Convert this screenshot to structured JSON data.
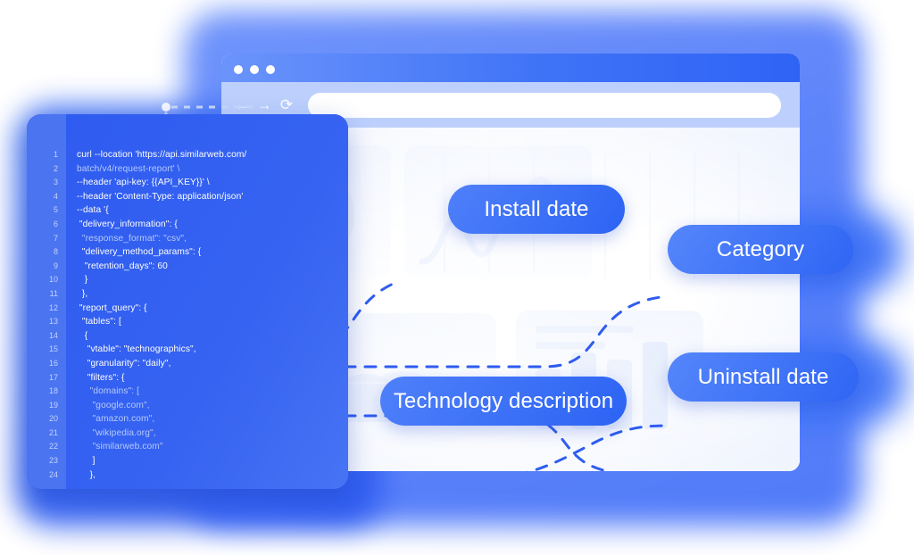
{
  "colors": {
    "accent": "#2f5cf0",
    "pill": "#3b6bf5",
    "pill_light": "#5586fb",
    "titlebar": "#3f73f7",
    "toolbar": "#bdd0fd",
    "halo": "#5b82fa",
    "gutter": "#4b74f1",
    "code_bg": "#2f5cf0",
    "dash_line": "#2f5cf0",
    "card_bg": "#ffffff",
    "page_bg": "#ffffff"
  },
  "browser": {
    "title_dots": [
      "close-dot",
      "minimize-dot",
      "maximize-dot"
    ],
    "nav": [
      {
        "name": "back-button",
        "glyph": "←"
      },
      {
        "name": "forward-button",
        "glyph": "→"
      },
      {
        "name": "reload-button",
        "glyph": "⟳"
      }
    ],
    "url_value": "",
    "url_placeholder": ""
  },
  "pills": [
    {
      "id": "install",
      "label": "Install date"
    },
    {
      "id": "category",
      "label": "Category"
    },
    {
      "id": "techdesc",
      "label": "Technology description"
    },
    {
      "id": "uninstall",
      "label": "Uninstall date"
    }
  ],
  "code_panel": {
    "language": "bash",
    "line_numbers": [
      "1",
      "2",
      "3",
      "4",
      "5",
      "6",
      "7",
      "8",
      "9",
      "10",
      "11",
      "12",
      "13",
      "14",
      "15",
      "16",
      "17",
      "18",
      "19",
      "20",
      "21",
      "22",
      "23",
      "24"
    ],
    "lines": [
      {
        "n": "1",
        "text": "curl --location 'https://api.similarweb.com/",
        "dim": false
      },
      {
        "n": "2",
        "text": "batch/v4/request-report' \\",
        "dim": true
      },
      {
        "n": "3",
        "text": "--header 'api-key: {{API_KEY}}' \\",
        "dim": false
      },
      {
        "n": "4",
        "text": "--header 'Content-Type: application/json'",
        "dim": false
      },
      {
        "n": "5",
        "text": "--data '{",
        "dim": false
      },
      {
        "n": "6",
        "text": " \"delivery_information\": {",
        "dim": false
      },
      {
        "n": "7",
        "text": "  \"response_format\": \"csv\",",
        "dim": true
      },
      {
        "n": "8",
        "text": "  \"delivery_method_params\": {",
        "dim": false
      },
      {
        "n": "9",
        "text": "   \"retention_days\": 60",
        "dim": false
      },
      {
        "n": "10",
        "text": "   }",
        "dim": false
      },
      {
        "n": "11",
        "text": "  },",
        "dim": false
      },
      {
        "n": "12",
        "text": " \"report_query\": {",
        "dim": false
      },
      {
        "n": "13",
        "text": "  \"tables\": [",
        "dim": false
      },
      {
        "n": "14",
        "text": "   {",
        "dim": false
      },
      {
        "n": "15",
        "text": "    \"vtable\": \"technographics\",",
        "dim": false
      },
      {
        "n": "16",
        "text": "    \"granularity\": \"daily\",",
        "dim": false
      },
      {
        "n": "17",
        "text": "    \"filters\": {",
        "dim": false
      },
      {
        "n": "18",
        "text": "     \"domains\": [",
        "dim": true
      },
      {
        "n": "19",
        "text": "      \"google.com\",",
        "dim": true
      },
      {
        "n": "20",
        "text": "      \"amazon.com\",",
        "dim": true
      },
      {
        "n": "21",
        "text": "      \"wikipedia.org\",",
        "dim": true
      },
      {
        "n": "22",
        "text": "      \"similarweb.com\"",
        "dim": true
      },
      {
        "n": "23",
        "text": "      ]",
        "dim": false
      },
      {
        "n": "24",
        "text": "     },",
        "dim": false
      }
    ]
  },
  "background_charts": [
    {
      "name": "donut-chart-placeholder",
      "type": "pie"
    },
    {
      "name": "line-chart-placeholder",
      "type": "line"
    },
    {
      "name": "area-chart-placeholder",
      "type": "area"
    },
    {
      "name": "bar-chart-placeholder",
      "type": "bar"
    }
  ],
  "connectors": {
    "count": 4,
    "style": "dashed",
    "color": "#2f5cf0"
  }
}
